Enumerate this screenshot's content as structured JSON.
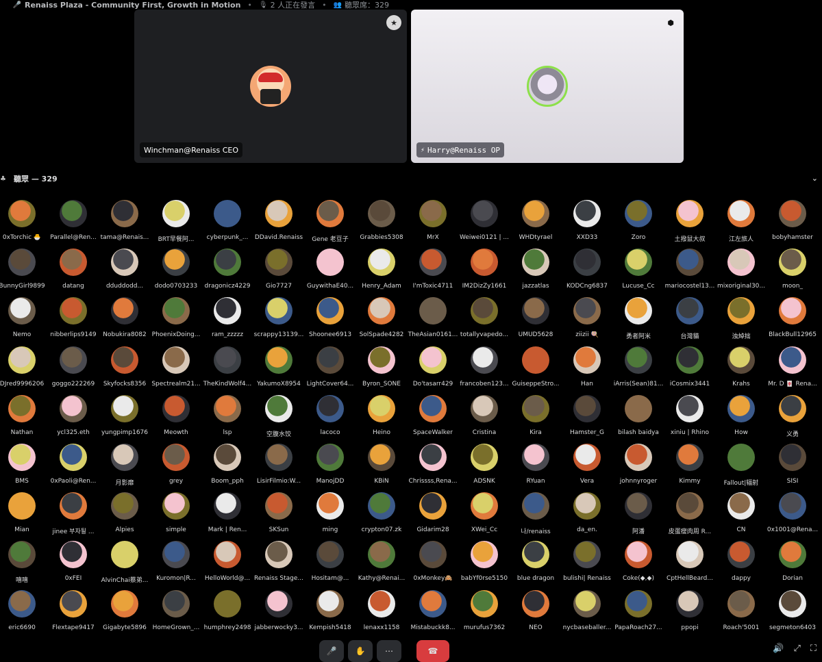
{
  "topbar": {
    "title": "Renaiss Plaza - Community First, Growth in Motion",
    "speaking": "2 人正在發言",
    "audience": "聽眾席：329"
  },
  "stage": [
    {
      "name": "Winchman@Renaiss CEO"
    },
    {
      "name": "Harry@Renaiss OP"
    }
  ],
  "audience_header": {
    "label": "聽眾 — 329"
  },
  "colors": [
    "#e07a3c",
    "#3b3f44",
    "#6b5c4a",
    "#4f7a3a",
    "#7a6f2b",
    "#5a4a3a",
    "#2f2f35",
    "#f4c3cf",
    "#8a6a4a",
    "#d9d06a",
    "#eaeaea",
    "#4a4a50",
    "#3c5a8a",
    "#c85a30",
    "#e9a23b",
    "#d8c8b8"
  ],
  "rows": [
    [
      "0xTorchic 🐣",
      "Parallel@Ren...",
      "tama@Renais...",
      "BRT早餐阿...",
      "cyberpunk_...",
      "DDavid.Renaiss",
      "Gene 老豆子",
      "Grabbies5308",
      "MrX",
      "Weiwei0121 | ...",
      "WHDtyrael",
      "XXD33",
      "Zoro",
      "土撥鼠大叔",
      "江左旅人",
      "bobyhamster"
    ],
    [
      "BunnyGirl9899",
      "datang",
      "dduddodd...",
      "dodo0703233",
      "dragonicz4229",
      "Gio7727",
      "GuywithaE40...",
      "Henry_Adam",
      "I'mToxic4711",
      "IM2DizZy1661",
      "jazzatlas",
      "KODCng6837",
      "Lucuse_Cc",
      "mariocostel13...",
      "mixoriginal30...",
      "moon_"
    ],
    [
      "Nemo",
      "nibberlips9149",
      "Nobukira8082",
      "PhoenixDoing...",
      "ram_zzzzz",
      "scrappy13139...",
      "Shoonee6913",
      "SolSpade4282",
      "TheAsian0161...",
      "totallyvapedo...",
      "UMUD5628",
      "ziizii 🍭",
      "勇者阿米",
      "台灣貓",
      "浊焯拙",
      "BlackBull12965"
    ],
    [
      "DJred9996206",
      "goggo222269",
      "Skyfocks8356",
      "Spectrealm21...",
      "TheKindWolf4...",
      "YakumoX8954",
      "LightCover64...",
      "Byron_SONE",
      "Do'tasarr429",
      "francoben123...",
      "GuiseppeStro...",
      "Han",
      "iArris(Sean)81...",
      "iCosmix3441",
      "Krahs",
      "Mr. D 🀄 Rena..."
    ],
    [
      "Nathan",
      "ycl325.eth",
      "yungpimp1676",
      "Meowth",
      "lsp",
      "空腹水饺",
      "lacoco",
      "Heino",
      "SpaceWalker",
      "Cristina",
      "Kira",
      "Hamster_G",
      "bilash baidya",
      "xiniu | Rhino",
      "How",
      "义勇"
    ],
    [
      "BMS",
      "0xPaoli@Ren...",
      "月影靡",
      "grey",
      "Boom_pph",
      "LisirFilmio:W...",
      "ManojDD",
      "KBiN",
      "Chrissss,Rena...",
      "ADSNK",
      "RYuan",
      "Vera",
      "johnnyroger",
      "Kimmy",
      "Fallout|辐射",
      "SISI"
    ],
    [
      "Mian",
      "jinee 부자될 ...",
      "Alpies",
      "simple",
      "Mark | Ren...",
      "SKSun",
      "ming",
      "crypton07.zk",
      "Gidarim28",
      "XWei_Cc",
      "나/renaiss",
      "da_en.",
      "阿潘",
      "皮蛋瘦肉周 R...",
      "CN",
      "0x1001@Rena..."
    ],
    [
      "嘻嘻",
      "0xFEI",
      "AlvinChai蔡弟...",
      "Kuromon|R...",
      "HelloWorld@...",
      "Renaiss Stage...",
      "Hositam@...",
      "Kathy@Renai...",
      "0xMonkey🙈",
      "babYf0rse5150",
      "blue dragon",
      "bulishi| Renaiss",
      "Coke(◆,◆)",
      "CptHellBeard...",
      "dappy",
      "Dorian"
    ],
    [
      "eric6690",
      "Flextape9417",
      "Gigabyte5896",
      "HomeGrown_...",
      "humphrey2498",
      "jabberwocky3...",
      "Kempish5418",
      "lenaxx1158",
      "Mistabuckk8...",
      "murufus7362",
      "NEO",
      "nycbaseballer...",
      "PapaRoach27...",
      "ppopi",
      "Roach'5001",
      "segmeton6403"
    ]
  ]
}
